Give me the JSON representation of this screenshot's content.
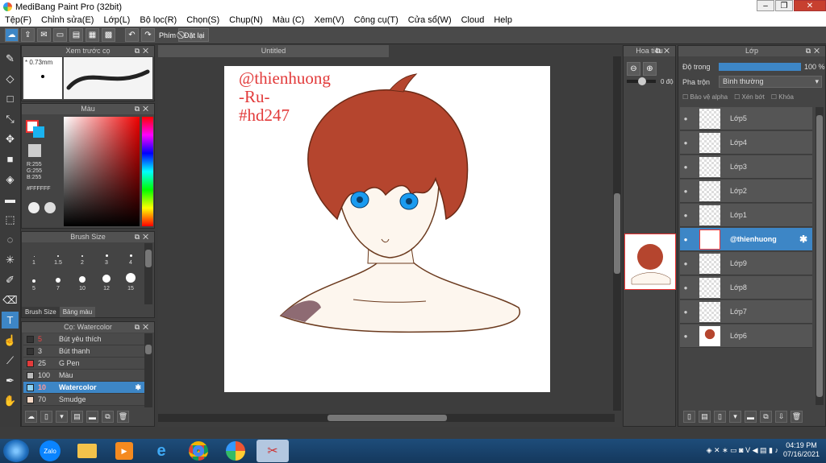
{
  "window": {
    "title": "MediBang Paint Pro (32bit)"
  },
  "menu": [
    "Tệp(F)",
    "Chỉnh sửa(E)",
    "Lớp(L)",
    "Bộ lọc(R)",
    "Chọn(S)",
    "Chụp(N)",
    "Màu (C)",
    "Xem(V)",
    "Công cụ(T)",
    "Cửa sổ(W)",
    "Cloud",
    "Help"
  ],
  "toolbar": {
    "label_phim": "Phím",
    "reset_label": "Đặt lại"
  },
  "brush_preview": {
    "title": "Xem trước cọ",
    "size_value": "0.73mm"
  },
  "color_panel": {
    "title": "Màu",
    "r": "R:255",
    "g": "G:255",
    "b": "B:255",
    "hex": "#FFFFFF"
  },
  "brush_size": {
    "title": "Brush Size",
    "sizes": [
      "1",
      "1.5",
      "2",
      "3",
      "4",
      "5",
      "7",
      "10",
      "12",
      "15"
    ],
    "tabs": [
      "Brush Size",
      "Bảng màu"
    ]
  },
  "brush_list": {
    "title": "Cọ: Watercolor",
    "items": [
      {
        "size": "5",
        "name": "Bút yêu thích",
        "swatch": "#333333"
      },
      {
        "size": "3",
        "name": "Bút thanh",
        "swatch": "#333333"
      },
      {
        "size": "25",
        "name": "G Pen",
        "swatch": "#e33b3b"
      },
      {
        "size": "100",
        "name": "Màu",
        "swatch": "#bbbbbb"
      },
      {
        "size": "10",
        "name": "Watercolor",
        "swatch": "#8fd3f5",
        "selected": true
      },
      {
        "size": "70",
        "name": "Smudge",
        "swatch": "#f5d8c4"
      }
    ]
  },
  "canvas": {
    "tab_title": "Untitled",
    "watermark": [
      "@thienhuong",
      "-Ru-",
      "#hd247"
    ]
  },
  "navigator": {
    "title": "Hoa tiêu",
    "angle": "0 độ"
  },
  "layers": {
    "title": "Lớp",
    "opacity_label": "Độ trong",
    "opacity_value": "100 %",
    "blend_label": "Pha trộn",
    "blend_value": "Bình thường",
    "checks": [
      "Bảo vệ alpha",
      "Xén bớt",
      "Khóa"
    ],
    "items": [
      {
        "name": "Lớp5"
      },
      {
        "name": "Lớp4"
      },
      {
        "name": "Lớp3"
      },
      {
        "name": "Lớp2"
      },
      {
        "name": "Lớp1"
      },
      {
        "name": "@thienhuong",
        "selected": true
      },
      {
        "name": "Lớp9"
      },
      {
        "name": "Lớp8"
      },
      {
        "name": "Lớp7"
      },
      {
        "name": "Lớp6"
      }
    ]
  },
  "taskbar": {
    "apps": [
      "Zalo"
    ],
    "time": "04:19 PM",
    "date": "07/16/2021"
  },
  "colors": {
    "accent": "#3d86c6",
    "hair": "#b5452e",
    "eyes": "#1a9bf0",
    "skin": "#fdf6ee"
  }
}
